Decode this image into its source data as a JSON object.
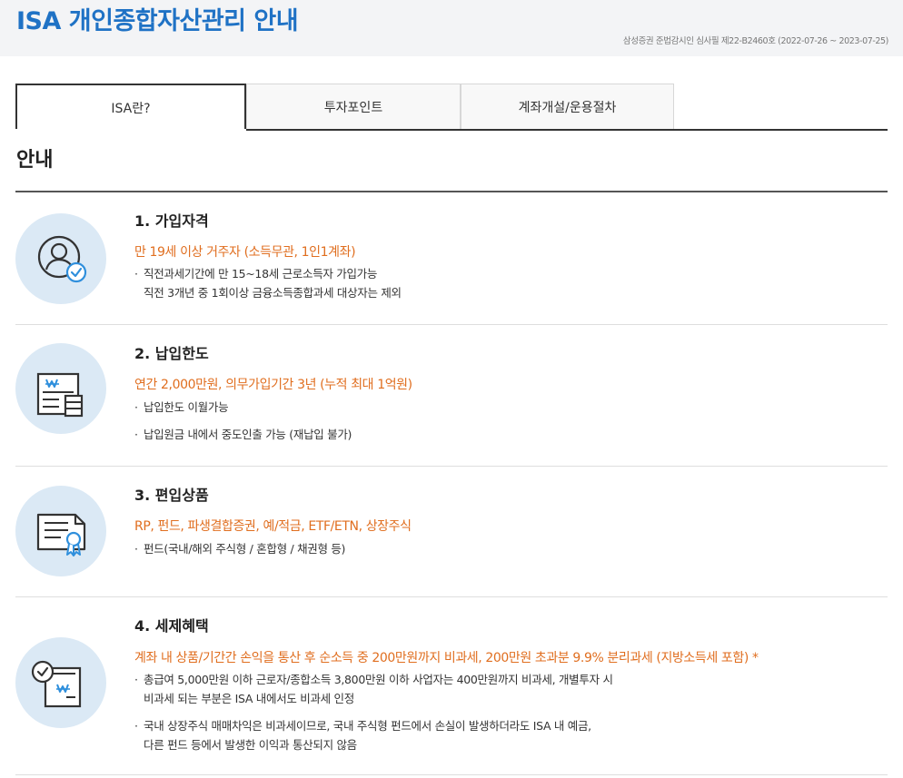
{
  "header": {
    "title": "ISA 개인종합자산관리 안내",
    "notice": "삼성증권 준법감시인 심사필 제22-B2460호 (2022-07-26 ~ 2023-07-25)"
  },
  "tabs": [
    {
      "label": "ISA란?",
      "active": true
    },
    {
      "label": "투자포인트",
      "active": false
    },
    {
      "label": "계좌개설/운용절차",
      "active": false
    }
  ],
  "section": {
    "title": "안내"
  },
  "items": [
    {
      "icon": "user-check-icon",
      "heading": "1. 가입자격",
      "summary": "만 19세 이상 거주자 (소득무관, 1인1계좌)",
      "bullets": [
        {
          "line1": "직전과세기간에 만 15~18세 근로소득자 가입가능",
          "line2": "직전 3개년 중 1회이상 금융소득종합과세 대상자는 제외"
        }
      ]
    },
    {
      "icon": "deposit-document-icon",
      "heading": "2. 납입한도",
      "summary": "연간 2,000만원, 의무가입기간 3년 (누적 최대 1억원)",
      "bullets": [
        {
          "line1": "납입한도 이월가능",
          "line2": ""
        },
        {
          "line1": "납입원금 내에서 중도인출 가능 (재납입 불가)",
          "line2": ""
        }
      ]
    },
    {
      "icon": "certificate-icon",
      "heading": "3. 편입상품",
      "summary": "RP, 펀드, 파생결합증권, 예/적금, ETF/ETN, 상장주식",
      "bullets": [
        {
          "line1": "펀드(국내/해외 주식형 / 혼합형 / 채권형 등)",
          "line2": ""
        }
      ]
    },
    {
      "icon": "tax-benefit-icon",
      "heading": "4. 세제혜택",
      "summary": "계좌 내 상품/기간간 손익을 통산 후 순소득 중 200만원까지 비과세, 200만원 초과분 9.9% 분리과세 (지방소득세 포함) *",
      "bullets": [
        {
          "line1": "총급여 5,000만원 이하 근로자/종합소득 3,800만원 이하 사업자는 400만원까지 비과세, 개별투자 시",
          "line2": "비과세 되는 부분은 ISA 내에서도 비과세 인정"
        },
        {
          "line1": "국내 상장주식 매매차익은 비과세이므로, 국내 주식형 펀드에서 손실이 발생하더라도 ISA 내 예금,",
          "line2": "다른 펀드 등에서 발생한 이익과 통산되지 않음"
        }
      ]
    }
  ],
  "colors": {
    "title_blue": "#1f72c5",
    "accent_orange": "#e06e1f",
    "icon_bg": "#dbe9f5",
    "icon_check_blue": "#2f8fdc"
  }
}
